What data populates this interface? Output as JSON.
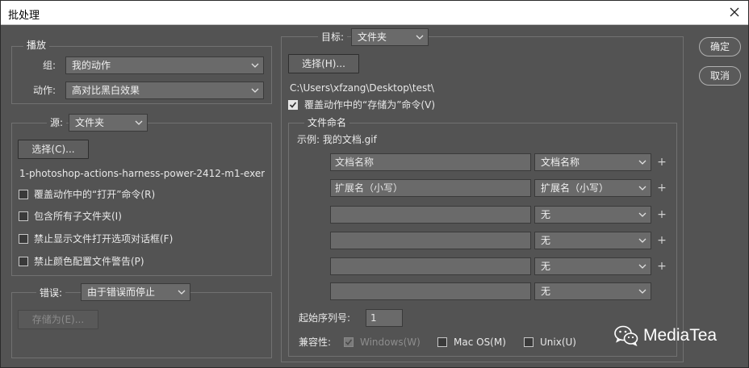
{
  "window": {
    "title": "批处理",
    "close_icon": "close-icon"
  },
  "play": {
    "legend": "播放",
    "group_label": "组:",
    "group_value": "我的动作",
    "action_label": "动作:",
    "action_value": "高对比黑白效果"
  },
  "source": {
    "label": "源:",
    "value": "文件夹",
    "choose_button": "选择(C)...",
    "path": "1-photoshop-actions-harness-power-2412-m1-exer...",
    "options": [
      {
        "label": "覆盖动作中的“打开”命令(R)",
        "checked": false
      },
      {
        "label": "包含所有子文件夹(I)",
        "checked": false
      },
      {
        "label": "禁止显示文件打开选项对话框(F)",
        "checked": false
      },
      {
        "label": "禁止颜色配置文件警告(P)",
        "checked": false
      }
    ]
  },
  "errors": {
    "label": "错误:",
    "value": "由于错误而停止",
    "save_button": "存储为(E)..."
  },
  "target": {
    "label": "目标:",
    "value": "文件夹",
    "choose_button": "选择(H)...",
    "path": "C:\\Users\\xfzang\\Desktop\\test\\",
    "override_save_label": "覆盖动作中的“存储为”命令(V)",
    "override_save_checked": true
  },
  "naming": {
    "legend": "文件命名",
    "example": "示例: 我的文档.gif",
    "rows": [
      {
        "input": "文档名称",
        "select": "文档名称",
        "has_plus": true
      },
      {
        "input": "扩展名（小写）",
        "select": "扩展名（小写）",
        "has_plus": true
      },
      {
        "input": "",
        "select": "无",
        "has_plus": true
      },
      {
        "input": "",
        "select": "无",
        "has_plus": true
      },
      {
        "input": "",
        "select": "无",
        "has_plus": true
      },
      {
        "input": "",
        "select": "无",
        "has_plus": false
      }
    ],
    "plus_symbol": "+",
    "serial_label": "起始序列号:",
    "serial_value": "1",
    "compat_label": "兼容性:",
    "compat": [
      {
        "label": "Windows(W)",
        "checked": true,
        "disabled": true
      },
      {
        "label": "Mac OS(M)",
        "checked": false,
        "disabled": false
      },
      {
        "label": "Unix(U)",
        "checked": false,
        "disabled": false
      }
    ]
  },
  "actions": {
    "ok": "确定",
    "cancel": "取消"
  },
  "watermark": {
    "text": "MediaTea",
    "icon": "wechat-icon"
  }
}
